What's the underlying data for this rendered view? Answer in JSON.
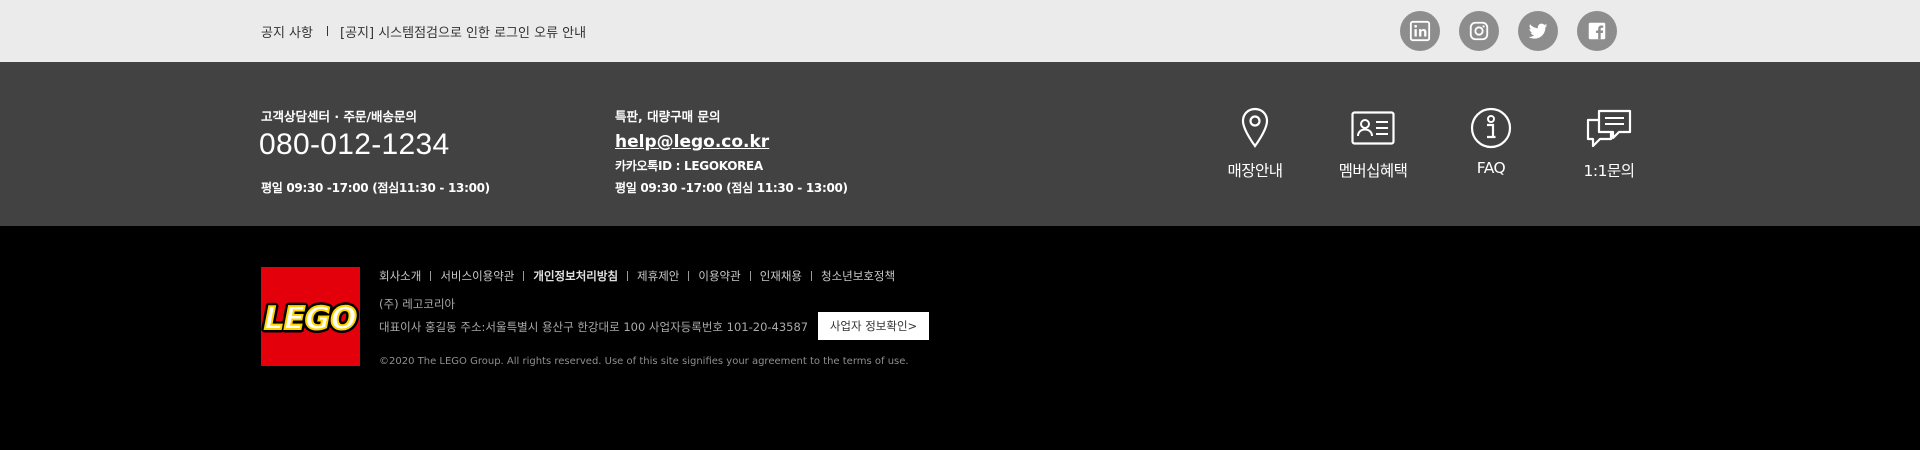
{
  "notice": {
    "label": "공지 사항",
    "text": "[공지] 시스템점검으로 인한 로그인 오류 안내"
  },
  "socials": [
    {
      "name": "linkedin-icon"
    },
    {
      "name": "instagram-icon"
    },
    {
      "name": "twitter-icon"
    },
    {
      "name": "facebook-icon"
    }
  ],
  "customer_service": {
    "title": "고객상담센터 · 주문/배송문의",
    "phone": "080-012-1234",
    "hours": "평일 09:30 -17:00 (점심11:30 - 13:00)"
  },
  "business": {
    "title": "특판, 대량구매 문의",
    "email": "help@lego.co.kr",
    "kakao": "카카오톡ID : LEGOKOREA",
    "hours": "평일 09:30 -17:00 (점심 11:30 - 13:00)"
  },
  "quick_links": [
    {
      "label": "매장안내",
      "icon": "location-pin-icon"
    },
    {
      "label": "멤버십혜택",
      "icon": "membership-card-icon"
    },
    {
      "label": "FAQ",
      "icon": "info-icon"
    },
    {
      "label": "1:1문의",
      "icon": "chat-bubbles-icon"
    }
  ],
  "footer": {
    "logo_text": "LEGO",
    "links": [
      "회사소개",
      "서비스이용약관",
      "개인정보처리방침",
      "제휴제안",
      "이용약관",
      "인재채용",
      "청소년보호정책"
    ],
    "company": "(주) 레고코리아",
    "address": "대표이사 홍길동 주소:서울특별시 용산구 한강대로 100 사업자등록번호 101-20-43587",
    "biz_check_label": "사업자 정보확인>",
    "copyright": "©2020 The LEGO Group. All rights reserved. Use of this site signifies your agreement to the terms of use."
  },
  "colors": {
    "notice_bg": "#ebebeb",
    "contact_bg": "#424242",
    "footer_bg": "#000000",
    "social_bg": "#8d8d8d",
    "lego_red": "#e3000b",
    "lego_yellow": "#ffd500"
  }
}
